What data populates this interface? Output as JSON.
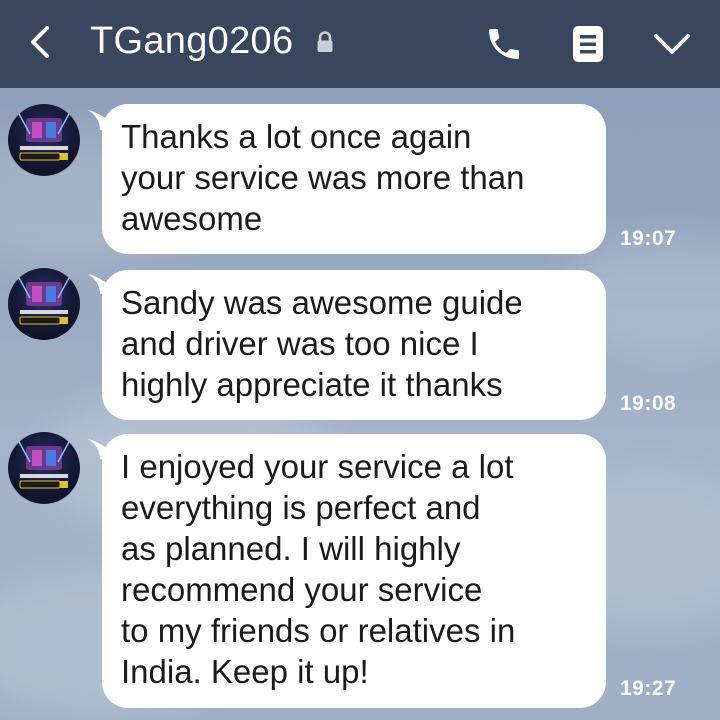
{
  "header": {
    "title": "TGang0206",
    "icons": {
      "back": "chevron-left-icon",
      "lock": "lock-icon",
      "call": "phone-icon",
      "memo": "notes-icon",
      "menu": "chevron-down-icon"
    },
    "background_color": "#39465d"
  },
  "messages": [
    {
      "sender": "TGang0206",
      "text": "Thanks a lot once again\nyour service was more than\nawesome",
      "time": "19:07"
    },
    {
      "sender": "TGang0206",
      "text": "Sandy was awesome guide\nand driver was too nice I\nhighly appreciate it thanks",
      "time": "19:08"
    },
    {
      "sender": "TGang0206",
      "text": "I enjoyed your service a lot\neverything is perfect and\nas planned. I will highly\nrecommend your service\nto my friends or relatives in\nIndia. Keep it up!",
      "time": "19:27"
    }
  ],
  "colors": {
    "bubble": "#ffffff",
    "timestamp": "#ffffff",
    "chat_background": "#93a4bd"
  }
}
